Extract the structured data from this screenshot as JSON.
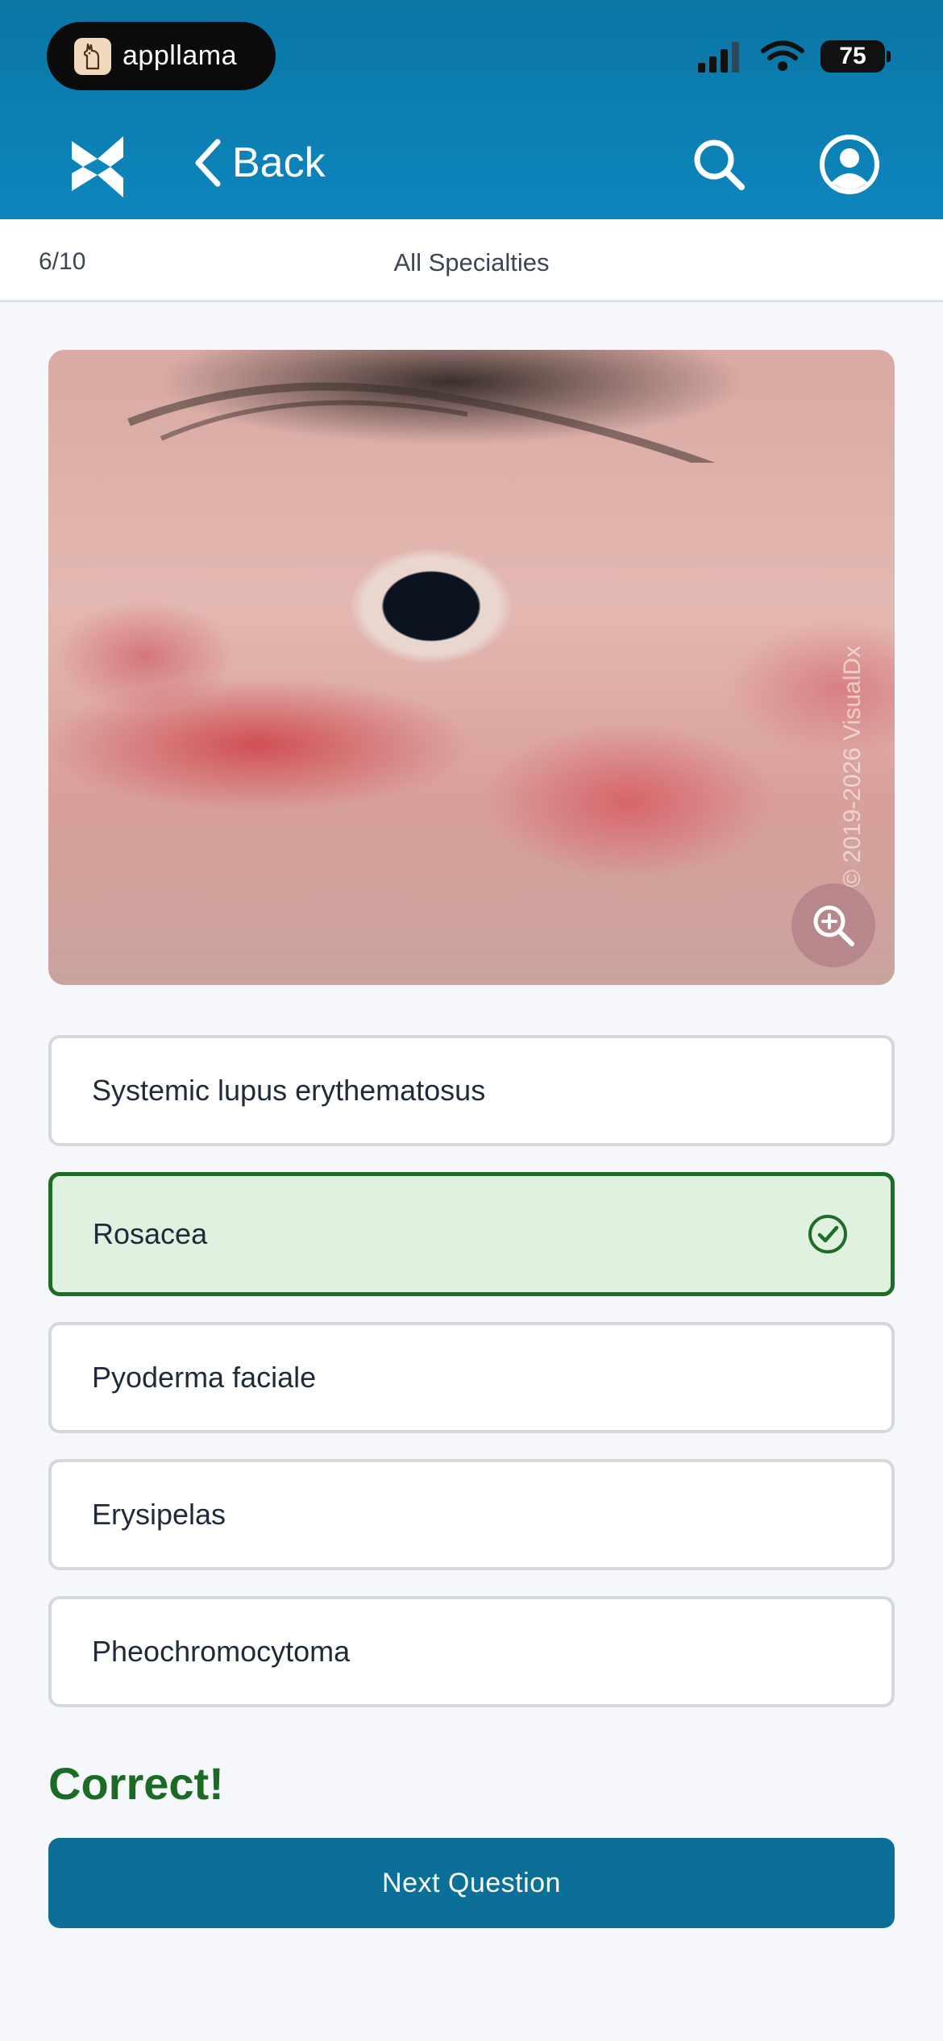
{
  "status_bar": {
    "app_pill_label": "appllama",
    "battery_level": "75"
  },
  "nav": {
    "back_label": "Back"
  },
  "quiz": {
    "progress": "6/10",
    "specialty": "All Specialties"
  },
  "image": {
    "watermark": "© 2019-2026 VisualDx"
  },
  "options": [
    {
      "label": "Systemic lupus erythematosus",
      "state": "default"
    },
    {
      "label": "Rosacea",
      "state": "correct"
    },
    {
      "label": "Pyoderma faciale",
      "state": "default"
    },
    {
      "label": "Erysipelas",
      "state": "default"
    },
    {
      "label": "Pheochromocytoma",
      "state": "default"
    }
  ],
  "result": {
    "message": "Correct!"
  },
  "next_button": {
    "label": "Next Question"
  },
  "colors": {
    "header": "#0d86bd",
    "correct_green": "#1d6d28",
    "correct_bg": "#e0f1df",
    "button": "#0c6f98"
  },
  "icons": {
    "logo": "visualdx-logo-icon",
    "back": "chevron-left-icon",
    "search": "search-icon",
    "profile": "user-circle-icon",
    "zoom": "zoom-in-icon",
    "check": "check-circle-icon"
  }
}
